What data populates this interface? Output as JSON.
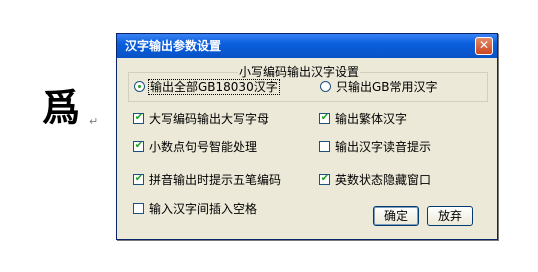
{
  "document": {
    "character": "爲",
    "paragraph_mark": "↵"
  },
  "dialog": {
    "title": "汉字输出参数设置",
    "close_label": "✕",
    "group": {
      "legend": "小写编码输出汉字设置",
      "options": [
        {
          "label": "输出全部GB18030汉字",
          "selected": true
        },
        {
          "label": "只输出GB常用汉字",
          "selected": false
        }
      ]
    },
    "checkboxes": [
      {
        "label": "大写编码输出大写字母",
        "checked": true
      },
      {
        "label": "输出繁体汉字",
        "checked": true
      },
      {
        "label": "小数点句号智能处理",
        "checked": true
      },
      {
        "label": "输出汉字读音提示",
        "checked": false
      },
      {
        "label": "拼音输出时提示五笔编码",
        "checked": true
      },
      {
        "label": "英数状态隐藏窗口",
        "checked": true
      },
      {
        "label": "输入汉字间插入空格",
        "checked": false
      }
    ],
    "check_mark": "✔",
    "ok_label": "确定",
    "cancel_label": "放弃"
  },
  "colors": {
    "title_bar": "#0a5fdd",
    "dialog_bg": "#ece9d8",
    "check": "#21a121",
    "close": "#c9471f"
  }
}
